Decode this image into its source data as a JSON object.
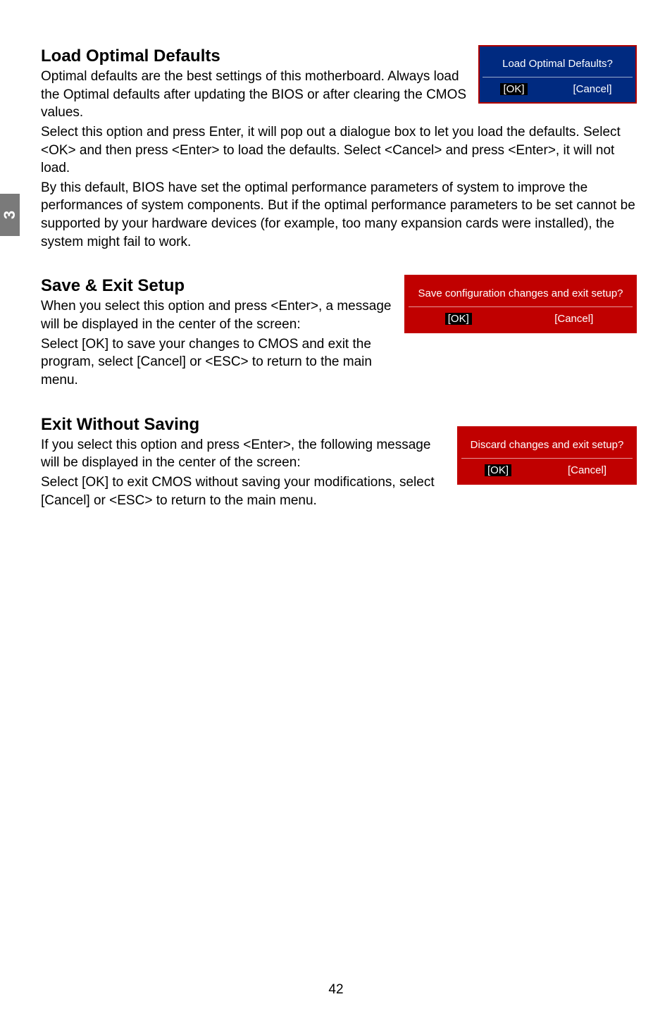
{
  "sideTab": "3",
  "pageNumber": "42",
  "section1": {
    "heading": "Load Optimal Defaults",
    "p1": "Optimal defaults are the best settings of this motherboard. Always load the Optimal defaults after updating the BIOS or after clearing the CMOS values.",
    "p2": "Select this option and press Enter, it will pop out a dialogue box to let you load the defaults. Select <OK> and then press <Enter> to load the defaults. Select <Cancel> and press <Enter>, it will not load.",
    "p3": "By this default, BIOS have set the optimal performance parameters of system to improve the performances of system components. But if the optimal performance parameters to be set cannot be supported by your hardware devices (for example, too many expansion cards were installed), the system might fail to work.",
    "dialog": {
      "title": "Load Optimal Defaults?",
      "ok": "[OK]",
      "cancel": "[Cancel]"
    }
  },
  "section2": {
    "heading": "Save & Exit Setup",
    "p1": "When you select this option and press <Enter>, a message will be displayed in the center of the screen:",
    "p2": "Select [OK] to save your changes to CMOS and exit the program, select [Cancel] or <ESC> to return to the main menu.",
    "dialog": {
      "title": "Save configuration changes and exit setup?",
      "ok": "[OK]",
      "cancel": "[Cancel]"
    }
  },
  "section3": {
    "heading": "Exit Without Saving",
    "p1": "If you select this option and press <Enter>, the following message will be displayed in the center of the screen:",
    "p2": "Select [OK] to exit CMOS without saving your modifications, select [Cancel] or <ESC> to return to the main menu.",
    "dialog": {
      "title": "Discard changes and exit setup?",
      "ok": "[OK]",
      "cancel": "[Cancel]"
    }
  }
}
